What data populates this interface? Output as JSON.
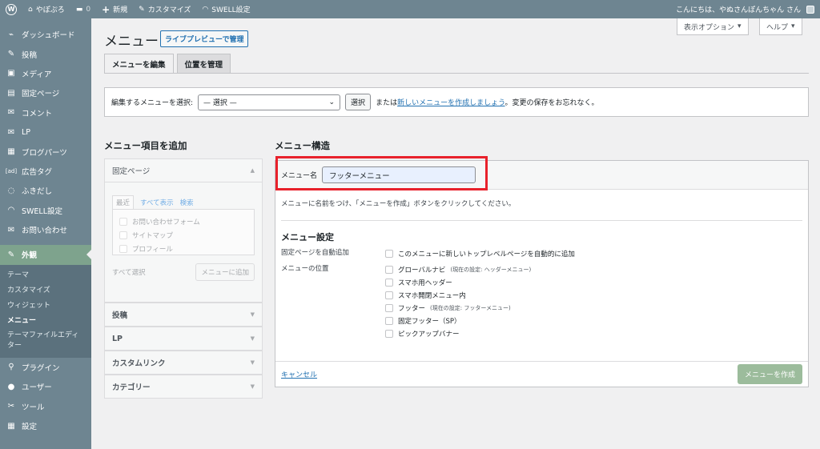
{
  "adminbar": {
    "site_name": "やぽぷろ",
    "comments_count": "0",
    "new_label": "新規",
    "customize_label": "カスタマイズ",
    "swell_label": "SWELL設定",
    "greeting": "こんにちは、やぬさんぽんちゃん さん"
  },
  "sidebar": {
    "items_top": [
      {
        "label": "ダッシュボード",
        "icon": "⌁"
      },
      {
        "label": "投稿",
        "icon": "✎"
      },
      {
        "label": "メディア",
        "icon": "▣"
      },
      {
        "label": "固定ページ",
        "icon": "▤"
      },
      {
        "label": "コメント",
        "icon": "✉"
      },
      {
        "label": "LP",
        "icon": "✉"
      },
      {
        "label": "ブログパーツ",
        "icon": "▦"
      },
      {
        "label": "広告タグ",
        "icon": "[ad]"
      },
      {
        "label": "ふきだし",
        "icon": "◌"
      },
      {
        "label": "SWELL設定",
        "icon": "◠"
      },
      {
        "label": "お問い合わせ",
        "icon": "✉"
      }
    ],
    "current": {
      "label": "外観",
      "icon": "✎"
    },
    "submenu": [
      "テーマ",
      "カスタマイズ",
      "ウィジェット",
      "メニュー",
      "テーマファイルエディ",
      "ター"
    ],
    "items_bottom": [
      {
        "label": "プラグイン",
        "icon": "⚲"
      },
      {
        "label": "ユーザー",
        "icon": "●"
      },
      {
        "label": "ツール",
        "icon": "✂"
      },
      {
        "label": "設定",
        "icon": "▦"
      }
    ]
  },
  "header": {
    "screen_options": "表示オプション",
    "help": "ヘルプ",
    "title": "メニュー",
    "preview_button": "ライブプレビューで管理",
    "tabs": [
      "メニューを編集",
      "位置を管理"
    ]
  },
  "select_bar": {
    "label": "編集するメニューを選択:",
    "select_value": "— 選択 —",
    "select_button": "選択",
    "or_text": "または",
    "create_link": "新しいメニューを作成しましょう",
    "after_text": "。変更の保存をお忘れなく。"
  },
  "add_panel": {
    "title": "メニュー項目を追加",
    "pages_title": "固定ページ",
    "mini_tabs": [
      "最近",
      "すべて表示",
      "検索"
    ],
    "pages": [
      "お問い合わせフォーム",
      "サイトマップ",
      "プロフィール"
    ],
    "select_all": "すべて選択",
    "add_button": "メニューに追加",
    "sections": [
      "投稿",
      "LP",
      "カスタムリンク",
      "カテゴリー"
    ]
  },
  "structure": {
    "title": "メニュー構造",
    "name_label": "メニュー名",
    "name_value": "フッターメニュー",
    "description": "メニューに名前をつけ、「メニューを作成」ボタンをクリックしてください。",
    "settings_title": "メニュー設定",
    "auto_add_label": "固定ページを自動追加",
    "auto_add_option": "このメニューに新しいトップレベルページを自動的に追加",
    "location_label": "メニューの位置",
    "locations": [
      {
        "name": "グローバルナビ",
        "note": "(現在の設定: ヘッダーメニュー)"
      },
      {
        "name": "スマホ用ヘッダー",
        "note": ""
      },
      {
        "name": "スマホ開閉メニュー内",
        "note": ""
      },
      {
        "name": "フッター",
        "note": "(現在の設定: フッターメニュー)"
      },
      {
        "name": "固定フッター（SP）",
        "note": ""
      },
      {
        "name": "ピックアップバナー",
        "note": ""
      }
    ],
    "cancel": "キャンセル",
    "create_button": "メニューを作成"
  }
}
